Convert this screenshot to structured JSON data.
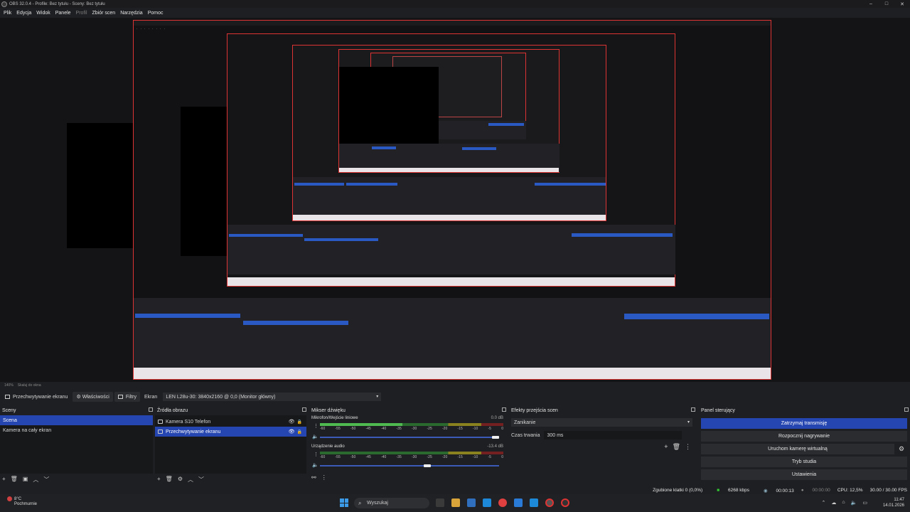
{
  "window": {
    "title": "OBS 32.0.4 - Profile: Bez tytułu - Sceny: Bez tytułu",
    "controls": [
      "–",
      "□",
      "✕"
    ]
  },
  "menu": [
    {
      "label": "Plik",
      "disabled": false
    },
    {
      "label": "Edycja",
      "disabled": false
    },
    {
      "label": "Widok",
      "disabled": false
    },
    {
      "label": "Panele",
      "disabled": false
    },
    {
      "label": "Profil",
      "disabled": true
    },
    {
      "label": "Zbiór scen",
      "disabled": false
    },
    {
      "label": "Narzędzia",
      "disabled": false
    },
    {
      "label": "Pomoc",
      "disabled": false
    }
  ],
  "preview_toolbar": {
    "zoom": "140%",
    "fit": "Skaluj do okna"
  },
  "source_toolbar": {
    "selected_source": "Przechwytywanie ekranu",
    "properties": "Właściwości",
    "filters": "Filtry",
    "display_label": "Ekran",
    "display_value": "LEN L28u-30: 3840x2160 @ 0,0 (Monitor główny)"
  },
  "scenes": {
    "title": "Sceny",
    "items": [
      {
        "label": "Scena",
        "selected": true
      },
      {
        "label": "Kamera na cały ekran",
        "selected": false
      }
    ],
    "footer": [
      "+",
      "🗑",
      "▣",
      "︿",
      "﹀"
    ]
  },
  "sources": {
    "title": "Źródła obrazu",
    "items": [
      {
        "label": "Kamera S10 Telefon",
        "selected": false,
        "icon": "camera-icon"
      },
      {
        "label": "Przechwytywanie ekranu",
        "selected": true,
        "icon": "monitor-icon"
      }
    ],
    "footer": [
      "+",
      "🗑",
      "⚙",
      "︿",
      "﹀"
    ]
  },
  "mixer": {
    "title": "Mikser dźwięku",
    "tracks": [
      {
        "name": "Mikrofon/Wejście liniowe",
        "db": "0.0 dB",
        "level": 0.45,
        "volume": 1.0
      },
      {
        "name": "Urządzenie audio",
        "db": "-13.4 dB",
        "level": 0.0,
        "volume": 0.62
      }
    ],
    "ticks": [
      "-60",
      "-55",
      "-50",
      "-45",
      "-40",
      "-35",
      "-30",
      "-25",
      "-20",
      "-15",
      "-10",
      "-5",
      "0"
    ]
  },
  "transitions": {
    "title": "Efekty przejścia scen",
    "selected": "Zanikanie",
    "duration_label": "Czas trwania",
    "duration_value": "300 ms"
  },
  "controls": {
    "title": "Panel sterujący",
    "buttons": [
      {
        "label": "Zatrzymaj transmisję",
        "primary": true
      },
      {
        "label": "Rozpocznij nagrywanie",
        "primary": false
      },
      {
        "label": "Uruchom kamerę wirtualną",
        "primary": false
      },
      {
        "label": "Tryb studia",
        "primary": false
      },
      {
        "label": "Ustawienia",
        "primary": false
      }
    ]
  },
  "status": {
    "dropped": "Zgubione klatki 0 (0,0%)",
    "bitrate": "6268 kbps",
    "stream_time": "00:00:13",
    "rec_time": "00:00:00",
    "cpu": "CPU: 12,5%",
    "fps": "30.00 / 30.00 FPS"
  },
  "taskbar": {
    "temp": "8°C",
    "weather": "Pochmurnie",
    "search_placeholder": "Wyszukaj",
    "time": "11:47",
    "date": "14.01.2026"
  },
  "colors": {
    "accent": "#2545b0",
    "record_red": "#d33333",
    "background": "#1e1f22"
  }
}
